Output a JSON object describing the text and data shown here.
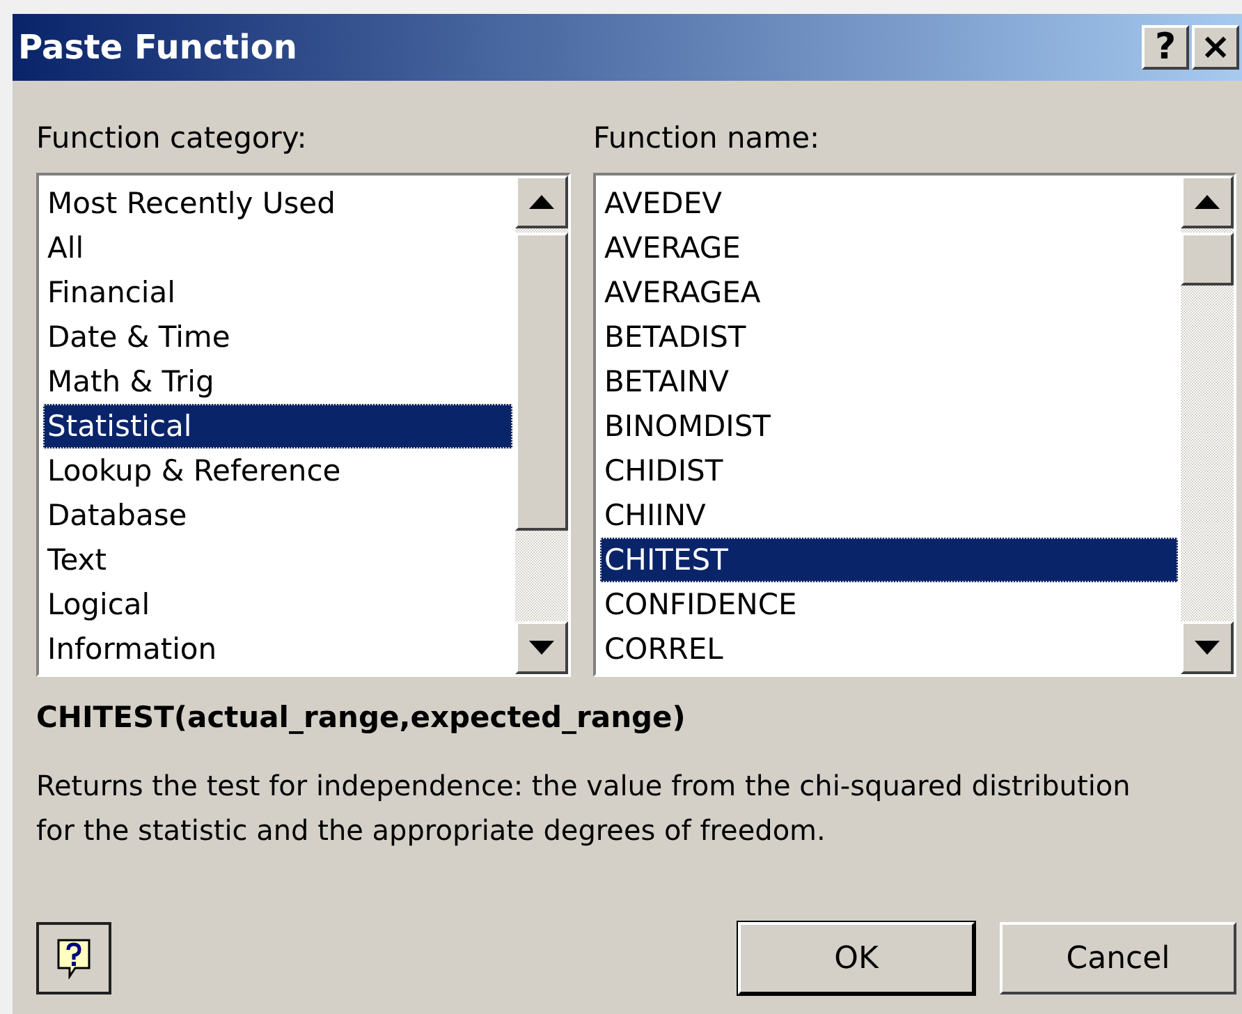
{
  "window": {
    "title": "Paste Function",
    "buttons": [
      "?",
      "×"
    ]
  },
  "category": {
    "label": "Function category:",
    "items": [
      {
        "label": "Most Recently Used",
        "selected": false
      },
      {
        "label": "All",
        "selected": false
      },
      {
        "label": "Financial",
        "selected": false
      },
      {
        "label": "Date & Time",
        "selected": false
      },
      {
        "label": "Math & Trig",
        "selected": false
      },
      {
        "label": "Statistical",
        "selected": true
      },
      {
        "label": "Lookup & Reference",
        "selected": false
      },
      {
        "label": "Database",
        "selected": false
      },
      {
        "label": "Text",
        "selected": false
      },
      {
        "label": "Logical",
        "selected": false
      },
      {
        "label": "Information",
        "selected": false
      }
    ]
  },
  "function": {
    "label": "Function name:",
    "items": [
      {
        "label": "AVEDEV",
        "selected": false
      },
      {
        "label": "AVERAGE",
        "selected": false
      },
      {
        "label": "AVERAGEA",
        "selected": false
      },
      {
        "label": "BETADIST",
        "selected": false
      },
      {
        "label": "BETAINV",
        "selected": false
      },
      {
        "label": "BINOMDIST",
        "selected": false
      },
      {
        "label": "CHIDIST",
        "selected": false
      },
      {
        "label": "CHIINV",
        "selected": false
      },
      {
        "label": "CHITEST",
        "selected": true
      },
      {
        "label": "CONFIDENCE",
        "selected": false
      },
      {
        "label": "CORREL",
        "selected": false
      }
    ]
  },
  "syntax": "CHITEST(actual_range,expected_range)",
  "description": "Returns the test for independence: the value from the chi-squared distribution for the statistic and the appropriate degrees of freedom.",
  "buttons": [
    "OK",
    "Cancel"
  ]
}
